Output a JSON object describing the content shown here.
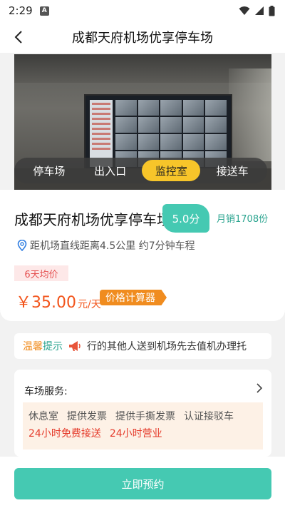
{
  "status_bar": {
    "time": "2:29",
    "notification_badge": "A",
    "icons": [
      "wifi-icon",
      "signal-icon",
      "battery-icon"
    ]
  },
  "nav": {
    "back_icon": "chevron-left-icon",
    "title": "成都天府机场优享停车场"
  },
  "hero": {
    "tabs": [
      {
        "label": "停车场",
        "active": false
      },
      {
        "label": "出入口",
        "active": false
      },
      {
        "label": "监控室",
        "active": true
      },
      {
        "label": "接送车",
        "active": false
      }
    ]
  },
  "parking": {
    "name": "成都天府机场优享停车场",
    "score": "5.0分",
    "monthly_sales": "月销1708份",
    "distance": "距机场直线距离4.5公里 约7分钟车程",
    "avg_tag": "6天均价",
    "price_amount": "￥35.00",
    "price_unit": "元/天",
    "calculator_label": "价格计算器"
  },
  "notice": {
    "prefix_1": "温馨",
    "prefix_2": "提示",
    "text": "行的其他人送到机场先去值机办理托"
  },
  "services": {
    "label": "车场服务:",
    "chips_row1": [
      "休息室",
      "提供发票",
      "提供手撕发票",
      "认证接驳车"
    ],
    "chips_row2": [
      "24小时免费接送",
      "24小时营业"
    ]
  },
  "action": {
    "book_label": "立即预约"
  },
  "colors": {
    "accent": "#45c9b2",
    "active_tab": "#f7c52a",
    "price": "#f2541b",
    "calc": "#f08c1f",
    "highlight_red": "#e53b2b"
  }
}
